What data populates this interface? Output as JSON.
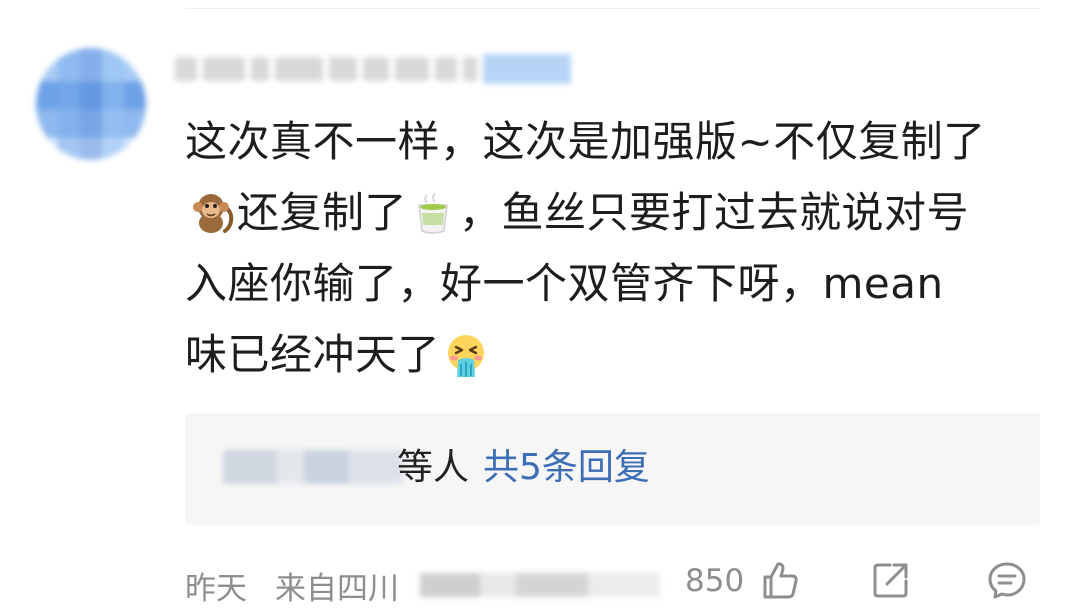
{
  "comment": {
    "lines": [
      "这次真不一样，这次是加强版~不仅复制了",
      "还复制了",
      "，鱼丝只要打过去就说对号",
      "入座你输了，好一个双管齐下呀，mean",
      "味已经冲天了"
    ]
  },
  "reply_preview": {
    "name_suffix": "等人",
    "count_text": "共5条回复"
  },
  "footer": {
    "time": "昨天",
    "location": "来自四川",
    "like_count": "850"
  },
  "icons": {
    "avatar": "avatar-image",
    "monkey": "monkey-emoji-icon",
    "tea": "green-tea-emoji-icon",
    "vomit": "vomiting-face-emoji-icon",
    "like": "thumbs-up-icon",
    "share": "share-icon",
    "comment": "comment-icon"
  },
  "colors": {
    "link": "#3d6db5",
    "meta": "#8e8e8e",
    "reply_bg": "#f6f6f6"
  }
}
